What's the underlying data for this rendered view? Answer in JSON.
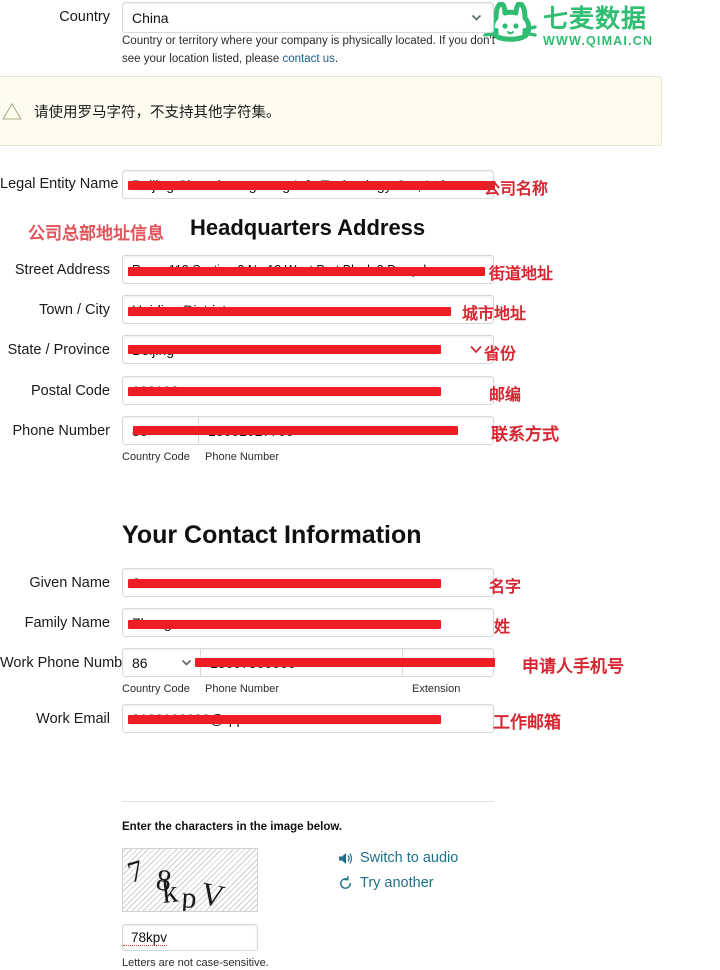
{
  "brand": {
    "cn_name": "七麦数据",
    "url": "WWW.QIMAI.CN",
    "color": "#2fbd72",
    "logo_icon": "cat-face-icon"
  },
  "country": {
    "label": "Country",
    "value": "China",
    "help_prefix": "Country or territory where your company is physically located. If you don't see your location listed, please ",
    "help_link": "contact us",
    "help_suffix": "."
  },
  "banner": {
    "icon": "warning-triangle-icon",
    "text": "请使用罗马字符，不支持其他字符集。"
  },
  "legal_entity": {
    "label": "Legal Entity Name",
    "value": "Beijing Shaoshuangwang Info Technology Co., Ltd.",
    "annotation": "公司名称"
  },
  "hq": {
    "heading": "Headquarters Address",
    "heading_annotation": "公司总部地址信息",
    "fields": [
      {
        "label": "Street Address",
        "value": "Room 112 Section 2 No 18 West Part Block 2 Dongsher",
        "annotation": "街道地址"
      },
      {
        "label": "Town / City",
        "value": "Haidian District",
        "annotation": "城市地址"
      },
      {
        "label": "State / Province",
        "value": "Beijing",
        "annotation": "省份"
      },
      {
        "label": "Postal Code",
        "value": "100193",
        "annotation": "邮编"
      }
    ],
    "phone": {
      "label": "Phone Number",
      "country_code": "86",
      "number": "18001027700",
      "annotation": "联系方式",
      "sub_country_code": "Country Code",
      "sub_phone_number": "Phone Number"
    }
  },
  "contact": {
    "heading": "Your Contact Information",
    "given_name": {
      "label": "Given Name",
      "value": "Jun",
      "annotation": "名字"
    },
    "family_name": {
      "label": "Family Name",
      "value": "Zhang",
      "annotation": "姓"
    },
    "work_phone": {
      "label": "Work Phone Number",
      "country_code": "86",
      "number": "18007500000",
      "annotation": "申请人手机号",
      "sub_country_code": "Country Code",
      "sub_phone_number": "Phone Number",
      "sub_extension": "Extension"
    },
    "work_email": {
      "label": "Work Email",
      "value": "8100100000@qq.com",
      "annotation": "工作邮箱"
    }
  },
  "captcha": {
    "prompt": "Enter the characters in the image below.",
    "image_text": "78kpV",
    "input_value": "78kpv",
    "note": "Letters are not case-sensitive.",
    "audio_link": "Switch to audio",
    "audio_icon": "speaker-icon",
    "retry_link": "Try another",
    "retry_icon": "refresh-icon"
  }
}
